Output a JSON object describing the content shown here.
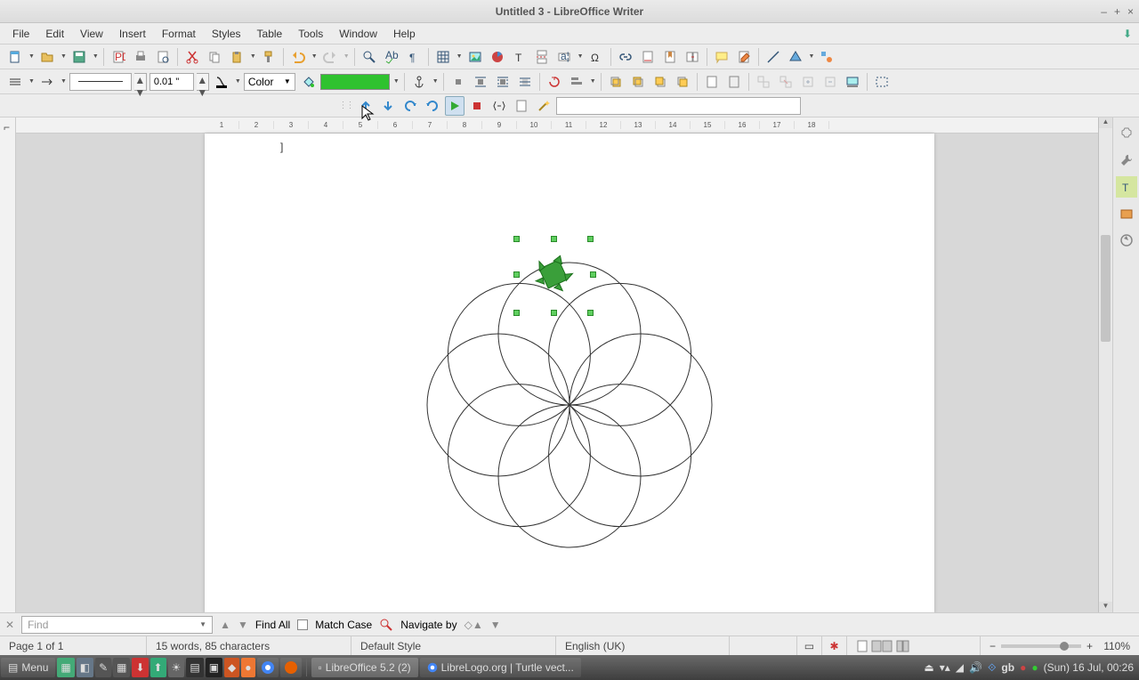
{
  "window": {
    "title": "Untitled 3 - LibreOffice Writer"
  },
  "menu": {
    "items": [
      "File",
      "Edit",
      "View",
      "Insert",
      "Format",
      "Styles",
      "Table",
      "Tools",
      "Window",
      "Help"
    ]
  },
  "toolbar2": {
    "line_width": "0.01 \"",
    "fill_type": "Color",
    "fill_color": "#2fc22f"
  },
  "ruler": {
    "marks": [
      1,
      2,
      3,
      4,
      5,
      6,
      7,
      8,
      9,
      10,
      11,
      12,
      13,
      14,
      15,
      16,
      17,
      18
    ]
  },
  "page": {
    "text_line": "]"
  },
  "findbar": {
    "placeholder": "Find",
    "find_all": "Find All",
    "match_case": "Match Case",
    "navigate": "Navigate by"
  },
  "status": {
    "page": "Page 1 of 1",
    "words": "15 words, 85 characters",
    "style": "Default Style",
    "lang": "English (UK)",
    "zoom": "110%"
  },
  "taskbar": {
    "menu": "Menu",
    "app": "LibreOffice 5.2 (2)",
    "browser": "LibreLogo.org | Turtle vect...",
    "clock": "(Sun) 16 Jul, 00:26",
    "kb": "gb"
  }
}
